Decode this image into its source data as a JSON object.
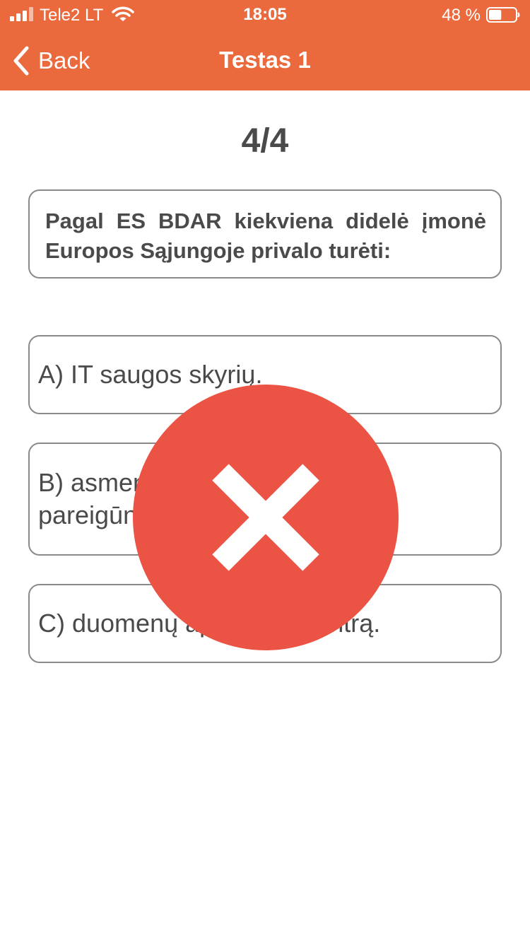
{
  "status_bar": {
    "carrier": "Tele2 LT",
    "time": "18:05",
    "battery_percent": "48 %",
    "battery_level": 0.48,
    "icons": [
      "signal-icon",
      "wifi-icon",
      "battery-icon"
    ]
  },
  "nav": {
    "back_label": "Back",
    "title": "Testas 1"
  },
  "quiz": {
    "progress": "4/4",
    "question": "Pagal ES BDAR kiekviena didelė įmonė Europos Sąjungoje privalo turėti:",
    "answers": [
      {
        "label": "A) IT saugos skyrių."
      },
      {
        "label": "B) asmens duomenų apsaugos pareigūną."
      },
      {
        "label": "C) duomenų apsaugos centrą."
      }
    ],
    "result_icon": "close-icon"
  },
  "colors": {
    "header": "#ea6a3e",
    "wrong": "#eb5345",
    "text": "#4a4a4a",
    "border": "#8a8a8a"
  }
}
